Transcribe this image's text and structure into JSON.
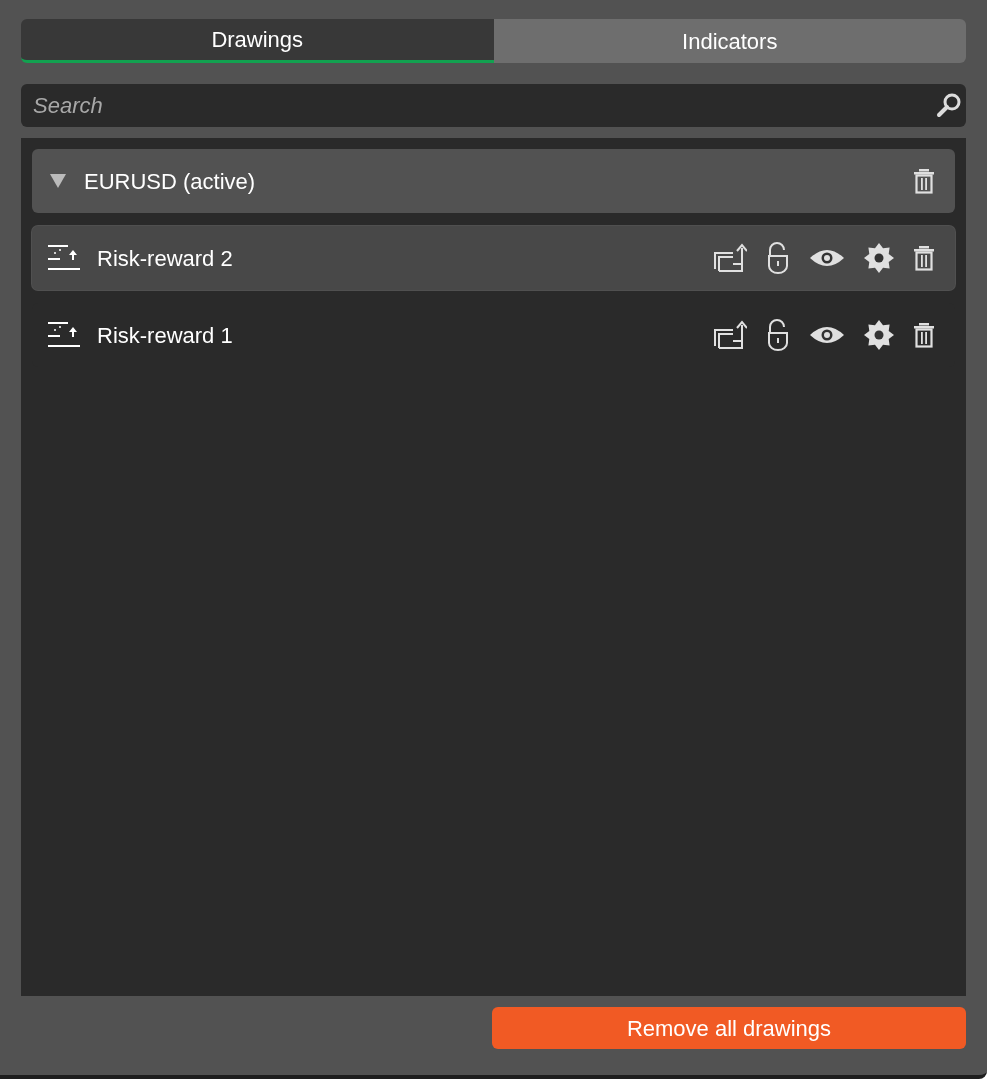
{
  "tabs": [
    {
      "label": "Drawings",
      "selected": true
    },
    {
      "label": "Indicators",
      "selected": false
    }
  ],
  "search": {
    "placeholder": "Search"
  },
  "groups": [
    {
      "title": "EURUSD (active)",
      "expanded": true,
      "items": [
        {
          "name": "Risk-reward 2",
          "selected": true
        },
        {
          "name": "Risk-reward 1",
          "selected": false
        }
      ]
    }
  ],
  "remove_button": "Remove all drawings"
}
